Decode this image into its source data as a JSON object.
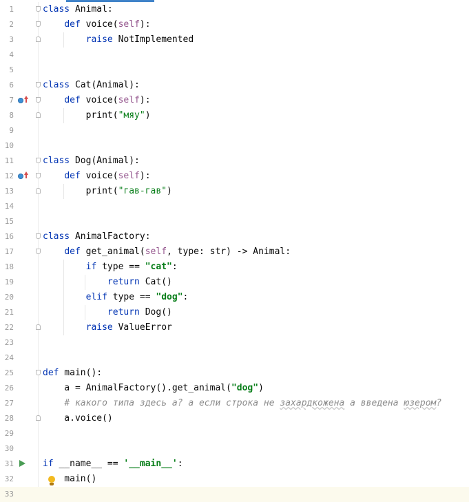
{
  "editor": {
    "language": "python",
    "current_line": 33,
    "lines": [
      {
        "n": "1",
        "tokens": [
          {
            "t": "class",
            "c": "kw"
          },
          {
            "t": " Animal:"
          }
        ]
      },
      {
        "n": "2",
        "tokens": [
          {
            "t": "    "
          },
          {
            "t": "def",
            "c": "kw"
          },
          {
            "t": " voice("
          },
          {
            "t": "self",
            "c": "self"
          },
          {
            "t": "):"
          }
        ]
      },
      {
        "n": "3",
        "tokens": [
          {
            "t": "        "
          },
          {
            "t": "raise",
            "c": "kw"
          },
          {
            "t": " NotImplemented"
          }
        ]
      },
      {
        "n": "4",
        "tokens": []
      },
      {
        "n": "5",
        "tokens": []
      },
      {
        "n": "6",
        "tokens": [
          {
            "t": "class",
            "c": "kw"
          },
          {
            "t": " Cat(Animal):"
          }
        ]
      },
      {
        "n": "7",
        "tokens": [
          {
            "t": "    "
          },
          {
            "t": "def",
            "c": "kw"
          },
          {
            "t": " voice("
          },
          {
            "t": "self",
            "c": "self"
          },
          {
            "t": "):"
          }
        ]
      },
      {
        "n": "8",
        "tokens": [
          {
            "t": "        print("
          },
          {
            "t": "\"мяу\"",
            "c": "str"
          },
          {
            "t": ")"
          }
        ]
      },
      {
        "n": "9",
        "tokens": []
      },
      {
        "n": "10",
        "tokens": []
      },
      {
        "n": "11",
        "tokens": [
          {
            "t": "class",
            "c": "kw"
          },
          {
            "t": " Dog(Animal):"
          }
        ]
      },
      {
        "n": "12",
        "tokens": [
          {
            "t": "    "
          },
          {
            "t": "def",
            "c": "kw"
          },
          {
            "t": " voice("
          },
          {
            "t": "self",
            "c": "self"
          },
          {
            "t": "):"
          }
        ]
      },
      {
        "n": "13",
        "tokens": [
          {
            "t": "        print("
          },
          {
            "t": "\"гав-гав\"",
            "c": "str"
          },
          {
            "t": ")"
          }
        ]
      },
      {
        "n": "14",
        "tokens": []
      },
      {
        "n": "15",
        "tokens": []
      },
      {
        "n": "16",
        "tokens": [
          {
            "t": "class",
            "c": "kw"
          },
          {
            "t": " AnimalFactory:"
          }
        ]
      },
      {
        "n": "17",
        "tokens": [
          {
            "t": "    "
          },
          {
            "t": "def",
            "c": "kw"
          },
          {
            "t": " get_animal("
          },
          {
            "t": "self",
            "c": "self"
          },
          {
            "t": ", type: str) -> Animal:"
          }
        ]
      },
      {
        "n": "18",
        "tokens": [
          {
            "t": "        "
          },
          {
            "t": "if",
            "c": "kw"
          },
          {
            "t": " type == "
          },
          {
            "t": "\"cat\"",
            "c": "strb"
          },
          {
            "t": ":"
          }
        ]
      },
      {
        "n": "19",
        "tokens": [
          {
            "t": "            "
          },
          {
            "t": "return",
            "c": "kw"
          },
          {
            "t": " Cat()"
          }
        ]
      },
      {
        "n": "20",
        "tokens": [
          {
            "t": "        "
          },
          {
            "t": "elif",
            "c": "kw"
          },
          {
            "t": " type == "
          },
          {
            "t": "\"dog\"",
            "c": "strb"
          },
          {
            "t": ":"
          }
        ]
      },
      {
        "n": "21",
        "tokens": [
          {
            "t": "            "
          },
          {
            "t": "return",
            "c": "kw"
          },
          {
            "t": " Dog()"
          }
        ]
      },
      {
        "n": "22",
        "tokens": [
          {
            "t": "        "
          },
          {
            "t": "raise",
            "c": "kw"
          },
          {
            "t": " ValueError"
          }
        ]
      },
      {
        "n": "23",
        "tokens": []
      },
      {
        "n": "24",
        "tokens": []
      },
      {
        "n": "25",
        "tokens": [
          {
            "t": "def",
            "c": "kw"
          },
          {
            "t": " main():"
          }
        ]
      },
      {
        "n": "26",
        "tokens": [
          {
            "t": "    a = AnimalFactory().get_animal("
          },
          {
            "t": "\"dog\"",
            "c": "strb"
          },
          {
            "t": ")"
          }
        ]
      },
      {
        "n": "27",
        "tokens": [
          {
            "t": "    "
          },
          {
            "t": "# какого типа здесь a? а если строка не ",
            "c": "cm"
          },
          {
            "t": "захардкожена",
            "c": "cm typo"
          },
          {
            "t": " а введена ",
            "c": "cm"
          },
          {
            "t": "юзером",
            "c": "cm typo"
          },
          {
            "t": "?",
            "c": "cm"
          }
        ]
      },
      {
        "n": "28",
        "tokens": [
          {
            "t": "    a.voice()"
          }
        ]
      },
      {
        "n": "29",
        "tokens": []
      },
      {
        "n": "30",
        "tokens": []
      },
      {
        "n": "31",
        "tokens": [
          {
            "t": "if",
            "c": "kw"
          },
          {
            "t": " __name__ == "
          },
          {
            "t": "'__main__'",
            "c": "strb"
          },
          {
            "t": ":"
          }
        ]
      },
      {
        "n": "32",
        "tokens": [
          {
            "t": "    main()"
          }
        ]
      },
      {
        "n": "33",
        "tokens": []
      }
    ]
  },
  "gutter_icons": {
    "override_lines": [
      7,
      12
    ],
    "run_line": 31,
    "bulb_line": 32,
    "run_color": "#499c54",
    "override_color": "#3d8fd6",
    "bulb_color": "#f2b91f"
  },
  "colors": {
    "keyword": "#0033b3",
    "self": "#94558d",
    "string": "#067d17",
    "comment": "#8c8c8c",
    "line_number": "#999999",
    "current_line_bg": "#fcfaed",
    "tab_accent": "#4083c9"
  }
}
